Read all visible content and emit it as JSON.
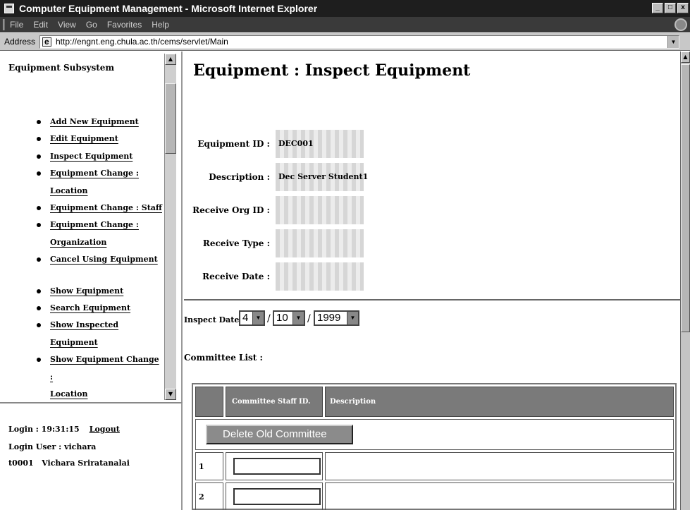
{
  "window": {
    "title": "Computer Equipment Management - Microsoft Internet Explorer",
    "controls": [
      "_",
      "□",
      "x"
    ]
  },
  "menu": [
    "File",
    "Edit",
    "View",
    "Go",
    "Favorites",
    "Help"
  ],
  "address": {
    "label": "Address",
    "url": "http://engnt.eng.chula.ac.th/cems/servlet/Main"
  },
  "sidebar": {
    "title": "Equipment Subsystem",
    "items": [
      "Add New Equipment",
      "Edit Equipment",
      "Inspect Equipment",
      "Equipment Change :",
      "Location",
      "Equipment Change : Staff",
      "Equipment Change :",
      "Organization",
      "Cancel Using Equipment",
      "",
      "Show Equipment",
      "Search Equipment",
      "Show Inspected Equipment",
      "Show Equipment Change :",
      "Location"
    ]
  },
  "login": {
    "login_label": "Login : 19:31:15",
    "logout": "Logout",
    "user_label": "Login User : vichara",
    "user_id": "t0001",
    "user_name": "Vichara Sriratanalai"
  },
  "main": {
    "title": "Equipment : Inspect Equipment",
    "fields": [
      {
        "label": "Equipment ID :",
        "value": "DEC001"
      },
      {
        "label": "Description :",
        "value": "Dec Server Student1"
      },
      {
        "label": "Receive Org ID :",
        "value": ""
      },
      {
        "label": "Receive Type :",
        "value": ""
      },
      {
        "label": "Receive Date :",
        "value": ""
      }
    ],
    "inspect_label": "Inspect Date :",
    "inspect_day": "4",
    "inspect_month": "10",
    "inspect_year": "1999",
    "separator": "/",
    "committee_label": "Committee List :",
    "table": {
      "headers": [
        "",
        "Committee Staff ID.",
        "Description"
      ],
      "delete_button": "Delete Old Committee",
      "rows": [
        "1",
        "2"
      ]
    }
  }
}
